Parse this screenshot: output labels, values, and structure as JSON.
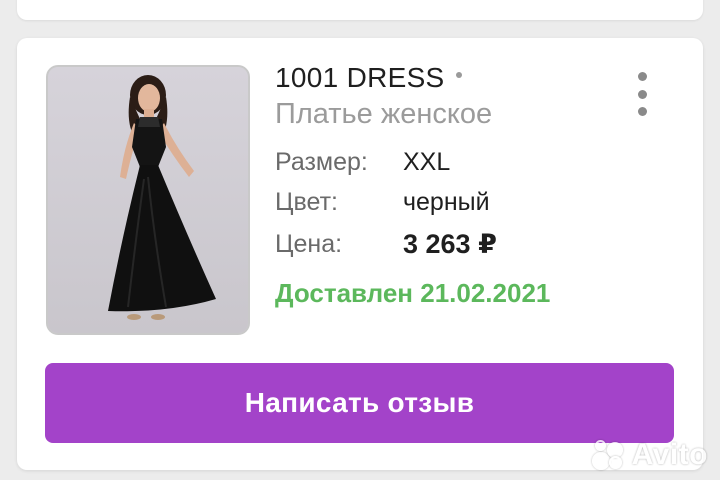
{
  "order": {
    "brand": "1001 DRESS",
    "product_name": "Платье женское",
    "attributes": [
      {
        "label": "Размер:",
        "value": "XXL"
      },
      {
        "label": "Цвет:",
        "value": "черный"
      },
      {
        "label": "Цена:",
        "value": "3 263 ₽"
      }
    ],
    "status": "Доставлен 21.02.2021",
    "review_button": "Написать отзыв"
  },
  "watermark": {
    "text": "Avito"
  },
  "colors": {
    "accent": "#a343c9",
    "status_delivered": "#5cb85c",
    "background": "#ececec",
    "card": "#ffffff"
  },
  "icons": {
    "more": "more-vertical-icon",
    "watermark": "avito-logo-icon"
  }
}
